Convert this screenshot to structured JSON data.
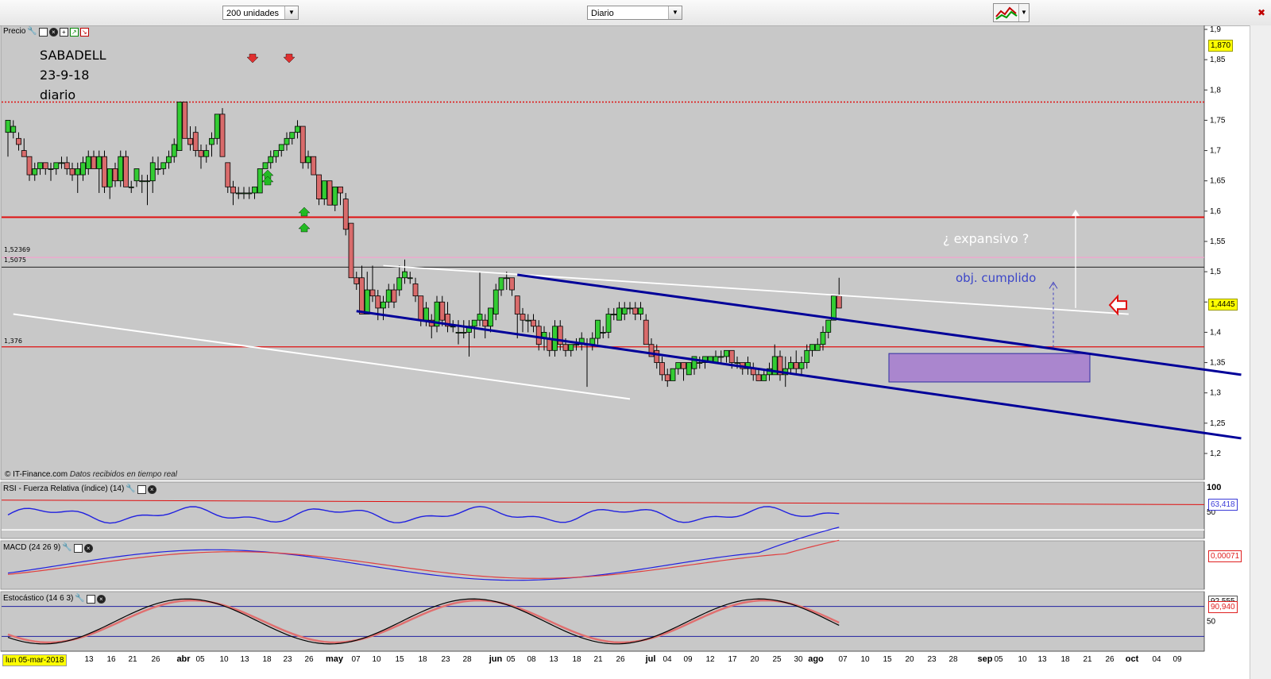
{
  "toolbar": {
    "units_select": "200 unidades",
    "period_select": "Diario",
    "chart_type_icon": "chart-type-icon",
    "close_icon": "close-icon"
  },
  "annotation": {
    "line1": "SABADELL",
    "line2": "23-9-18",
    "line3": "diario",
    "expansion": "¿ expansivo ?",
    "objective": "obj. cumplido"
  },
  "panels": {
    "price": "Precio",
    "rsi": "RSI - Fuerza Relativa (índice) (14)",
    "macd": "MACD (24 26 9)",
    "stoch": "Estocástico (14 6 3)"
  },
  "source_note": "© IT-Finance.com",
  "source_note_italic": "Datos recibidos en tiempo real",
  "current_date": "lun 05-mar-2018",
  "level_labels": {
    "top": "1,52369",
    "middle": "1,5075",
    "support": "1,376"
  },
  "price_tags": {
    "high": "1,870",
    "last": "1,4445",
    "rsi": "63,418",
    "macd": "0,00071",
    "stoch_a": "92,555",
    "stoch_b": "90,940"
  },
  "colors": {
    "background": "#c8c8c8",
    "bull": "#33cc33",
    "bear": "#d96b6b",
    "resistance": "#e01010",
    "channel": "#000099",
    "box": "#a070d0"
  },
  "chart_data": {
    "type": "candlestick",
    "title": "SABADELL",
    "ylim": [
      1.17,
      1.9
    ],
    "y_ticks": [
      "1,9",
      "1,85",
      "1,8",
      "1,75",
      "1,7",
      "1,65",
      "1,6",
      "1,55",
      "1,5",
      "1,45",
      "1,4",
      "1,35",
      "1,3",
      "1,25",
      "1,2"
    ],
    "x_ticks": [
      "13",
      "16",
      "21",
      "26",
      "abr",
      "05",
      "10",
      "13",
      "18",
      "23",
      "26",
      "may",
      "07",
      "10",
      "15",
      "18",
      "23",
      "28",
      "jun",
      "05",
      "08",
      "13",
      "18",
      "21",
      "26",
      "jul",
      "04",
      "09",
      "12",
      "17",
      "20",
      "25",
      "30",
      "ago",
      "07",
      "10",
      "15",
      "20",
      "23",
      "28",
      "sep",
      "05",
      "10",
      "13",
      "18",
      "21",
      "26",
      "oct",
      "04",
      "09"
    ],
    "horizontal_levels": [
      1.78,
      1.59,
      1.52369,
      1.5075,
      1.376
    ],
    "ohlc": [
      [
        1.73,
        1.75,
        1.69,
        1.75
      ],
      [
        1.73,
        1.75,
        1.72,
        1.74
      ],
      [
        1.72,
        1.73,
        1.7,
        1.71
      ],
      [
        1.7,
        1.72,
        1.69,
        1.69
      ],
      [
        1.69,
        1.69,
        1.65,
        1.66
      ],
      [
        1.66,
        1.68,
        1.65,
        1.67
      ],
      [
        1.67,
        1.68,
        1.66,
        1.68
      ],
      [
        1.68,
        1.68,
        1.66,
        1.67
      ],
      [
        1.67,
        1.68,
        1.65,
        1.67
      ],
      [
        1.67,
        1.68,
        1.66,
        1.68
      ],
      [
        1.68,
        1.69,
        1.67,
        1.68
      ],
      [
        1.68,
        1.69,
        1.66,
        1.67
      ],
      [
        1.67,
        1.68,
        1.65,
        1.66
      ],
      [
        1.66,
        1.68,
        1.63,
        1.67
      ],
      [
        1.66,
        1.69,
        1.65,
        1.68
      ],
      [
        1.67,
        1.7,
        1.66,
        1.69
      ],
      [
        1.69,
        1.7,
        1.67,
        1.67
      ],
      [
        1.67,
        1.7,
        1.63,
        1.69
      ],
      [
        1.69,
        1.7,
        1.63,
        1.64
      ],
      [
        1.64,
        1.67,
        1.62,
        1.67
      ],
      [
        1.67,
        1.68,
        1.64,
        1.65
      ],
      [
        1.65,
        1.7,
        1.64,
        1.69
      ],
      [
        1.69,
        1.7,
        1.64,
        1.64
      ],
      [
        1.64,
        1.65,
        1.63,
        1.64
      ],
      [
        1.65,
        1.67,
        1.64,
        1.67
      ],
      [
        1.65,
        1.66,
        1.63,
        1.65
      ],
      [
        1.65,
        1.66,
        1.61,
        1.65
      ],
      [
        1.65,
        1.69,
        1.63,
        1.68
      ],
      [
        1.67,
        1.69,
        1.66,
        1.67
      ],
      [
        1.67,
        1.68,
        1.66,
        1.68
      ],
      [
        1.68,
        1.7,
        1.67,
        1.69
      ],
      [
        1.69,
        1.72,
        1.68,
        1.71
      ],
      [
        1.7,
        1.78,
        1.7,
        1.78
      ],
      [
        1.78,
        1.78,
        1.72,
        1.72
      ],
      [
        1.72,
        1.74,
        1.7,
        1.71
      ],
      [
        1.73,
        1.74,
        1.69,
        1.7
      ],
      [
        1.7,
        1.71,
        1.67,
        1.69
      ],
      [
        1.69,
        1.71,
        1.68,
        1.7
      ],
      [
        1.71,
        1.73,
        1.69,
        1.72
      ],
      [
        1.72,
        1.76,
        1.71,
        1.76
      ],
      [
        1.76,
        1.77,
        1.69,
        1.69
      ],
      [
        1.68,
        1.68,
        1.63,
        1.64
      ],
      [
        1.64,
        1.65,
        1.61,
        1.63
      ],
      [
        1.63,
        1.64,
        1.62,
        1.63
      ],
      [
        1.63,
        1.64,
        1.62,
        1.63
      ],
      [
        1.63,
        1.64,
        1.62,
        1.63
      ],
      [
        1.63,
        1.64,
        1.62,
        1.64
      ],
      [
        1.63,
        1.67,
        1.63,
        1.67
      ],
      [
        1.67,
        1.68,
        1.67,
        1.68
      ],
      [
        1.68,
        1.7,
        1.67,
        1.69
      ],
      [
        1.69,
        1.7,
        1.68,
        1.7
      ],
      [
        1.7,
        1.71,
        1.69,
        1.71
      ],
      [
        1.71,
        1.73,
        1.7,
        1.72
      ],
      [
        1.72,
        1.73,
        1.71,
        1.73
      ],
      [
        1.73,
        1.75,
        1.72,
        1.74
      ],
      [
        1.74,
        1.74,
        1.67,
        1.68
      ],
      [
        1.68,
        1.7,
        1.67,
        1.69
      ],
      [
        1.69,
        1.69,
        1.66,
        1.66
      ],
      [
        1.66,
        1.66,
        1.61,
        1.62
      ],
      [
        1.62,
        1.65,
        1.61,
        1.65
      ],
      [
        1.65,
        1.65,
        1.61,
        1.61
      ],
      [
        1.61,
        1.64,
        1.6,
        1.64
      ],
      [
        1.64,
        1.64,
        1.61,
        1.63
      ],
      [
        1.62,
        1.63,
        1.56,
        1.57
      ],
      [
        1.58,
        1.58,
        1.49,
        1.49
      ],
      [
        1.49,
        1.5,
        1.47,
        1.48
      ],
      [
        1.49,
        1.51,
        1.43,
        1.43
      ],
      [
        1.43,
        1.5,
        1.43,
        1.47
      ],
      [
        1.47,
        1.51,
        1.45,
        1.46
      ],
      [
        1.46,
        1.47,
        1.42,
        1.44
      ],
      [
        1.44,
        1.46,
        1.42,
        1.45
      ],
      [
        1.45,
        1.48,
        1.44,
        1.47
      ],
      [
        1.47,
        1.48,
        1.44,
        1.45
      ],
      [
        1.47,
        1.51,
        1.46,
        1.49
      ],
      [
        1.49,
        1.52,
        1.48,
        1.5
      ],
      [
        1.49,
        1.5,
        1.48,
        1.49
      ],
      [
        1.48,
        1.49,
        1.45,
        1.46
      ],
      [
        1.46,
        1.46,
        1.41,
        1.42
      ],
      [
        1.42,
        1.45,
        1.41,
        1.44
      ],
      [
        1.42,
        1.43,
        1.39,
        1.41
      ],
      [
        1.41,
        1.46,
        1.4,
        1.45
      ],
      [
        1.45,
        1.46,
        1.41,
        1.42
      ],
      [
        1.43,
        1.45,
        1.4,
        1.41
      ],
      [
        1.41,
        1.42,
        1.4,
        1.41
      ],
      [
        1.4,
        1.42,
        1.38,
        1.4
      ],
      [
        1.4,
        1.42,
        1.39,
        1.4
      ],
      [
        1.4,
        1.42,
        1.36,
        1.41
      ],
      [
        1.41,
        1.42,
        1.39,
        1.42
      ],
      [
        1.42,
        1.5,
        1.41,
        1.43
      ],
      [
        1.42,
        1.43,
        1.39,
        1.41
      ],
      [
        1.41,
        1.44,
        1.4,
        1.44
      ],
      [
        1.43,
        1.48,
        1.42,
        1.47
      ],
      [
        1.47,
        1.49,
        1.46,
        1.49
      ],
      [
        1.49,
        1.5,
        1.47,
        1.49
      ],
      [
        1.49,
        1.49,
        1.46,
        1.47
      ],
      [
        1.46,
        1.46,
        1.39,
        1.43
      ],
      [
        1.43,
        1.44,
        1.4,
        1.42
      ],
      [
        1.42,
        1.43,
        1.4,
        1.42
      ],
      [
        1.42,
        1.43,
        1.4,
        1.41
      ],
      [
        1.41,
        1.42,
        1.37,
        1.38
      ],
      [
        1.39,
        1.41,
        1.37,
        1.4
      ],
      [
        1.39,
        1.4,
        1.36,
        1.37
      ],
      [
        1.37,
        1.42,
        1.36,
        1.41
      ],
      [
        1.41,
        1.42,
        1.37,
        1.38
      ],
      [
        1.38,
        1.39,
        1.36,
        1.37
      ],
      [
        1.37,
        1.38,
        1.36,
        1.38
      ],
      [
        1.38,
        1.39,
        1.37,
        1.38
      ],
      [
        1.38,
        1.4,
        1.37,
        1.39
      ],
      [
        1.38,
        1.39,
        1.31,
        1.38
      ],
      [
        1.38,
        1.4,
        1.37,
        1.39
      ],
      [
        1.39,
        1.42,
        1.38,
        1.42
      ],
      [
        1.4,
        1.41,
        1.39,
        1.4
      ],
      [
        1.4,
        1.44,
        1.39,
        1.43
      ],
      [
        1.43,
        1.44,
        1.42,
        1.43
      ],
      [
        1.42,
        1.45,
        1.42,
        1.44
      ],
      [
        1.43,
        1.45,
        1.42,
        1.44
      ],
      [
        1.44,
        1.45,
        1.43,
        1.44
      ],
      [
        1.44,
        1.45,
        1.42,
        1.43
      ],
      [
        1.43,
        1.45,
        1.42,
        1.44
      ],
      [
        1.42,
        1.43,
        1.38,
        1.38
      ],
      [
        1.38,
        1.39,
        1.36,
        1.36
      ],
      [
        1.37,
        1.38,
        1.34,
        1.35
      ],
      [
        1.35,
        1.36,
        1.32,
        1.33
      ],
      [
        1.33,
        1.34,
        1.31,
        1.32
      ],
      [
        1.32,
        1.34,
        1.32,
        1.34
      ],
      [
        1.34,
        1.35,
        1.33,
        1.35
      ],
      [
        1.35,
        1.35,
        1.32,
        1.34
      ],
      [
        1.33,
        1.35,
        1.33,
        1.35
      ],
      [
        1.34,
        1.36,
        1.33,
        1.36
      ],
      [
        1.35,
        1.36,
        1.34,
        1.35
      ],
      [
        1.35,
        1.36,
        1.34,
        1.36
      ],
      [
        1.35,
        1.36,
        1.35,
        1.36
      ],
      [
        1.35,
        1.37,
        1.35,
        1.36
      ],
      [
        1.36,
        1.37,
        1.35,
        1.36
      ],
      [
        1.36,
        1.37,
        1.35,
        1.37
      ],
      [
        1.37,
        1.37,
        1.34,
        1.35
      ],
      [
        1.35,
        1.36,
        1.34,
        1.35
      ],
      [
        1.35,
        1.35,
        1.33,
        1.34
      ],
      [
        1.34,
        1.36,
        1.33,
        1.35
      ],
      [
        1.34,
        1.35,
        1.32,
        1.33
      ],
      [
        1.33,
        1.34,
        1.32,
        1.32
      ],
      [
        1.32,
        1.34,
        1.32,
        1.33
      ],
      [
        1.33,
        1.35,
        1.32,
        1.34
      ],
      [
        1.33,
        1.38,
        1.33,
        1.36
      ],
      [
        1.36,
        1.37,
        1.32,
        1.33
      ],
      [
        1.33,
        1.36,
        1.31,
        1.34
      ],
      [
        1.34,
        1.36,
        1.33,
        1.35
      ],
      [
        1.35,
        1.37,
        1.33,
        1.34
      ],
      [
        1.34,
        1.36,
        1.33,
        1.35
      ],
      [
        1.35,
        1.38,
        1.34,
        1.37
      ],
      [
        1.37,
        1.38,
        1.36,
        1.38
      ],
      [
        1.37,
        1.39,
        1.37,
        1.38
      ],
      [
        1.38,
        1.41,
        1.37,
        1.4
      ],
      [
        1.4,
        1.42,
        1.39,
        1.42
      ],
      [
        1.42,
        1.46,
        1.42,
        1.46
      ],
      [
        1.46,
        1.49,
        1.44,
        1.44
      ]
    ],
    "trend_lines": [
      {
        "name": "directriz bajista",
        "points": [
          [
            1,
            1.43
          ],
          [
            116,
            1.29
          ]
        ]
      },
      {
        "name": "directriz superior",
        "points": [
          [
            70,
            1.51
          ],
          [
            209,
            1.43
          ]
        ]
      },
      {
        "name": "canal superior",
        "points": [
          [
            95,
            1.495
          ],
          [
            230,
            1.33
          ]
        ]
      },
      {
        "name": "canal inferior",
        "points": [
          [
            65,
            1.435
          ],
          [
            230,
            1.225
          ]
        ]
      }
    ],
    "rsi": {
      "ylim": [
        0,
        100
      ],
      "levels": [
        70,
        30
      ],
      "last": 63.418
    },
    "macd": {
      "last": 0.00071
    },
    "stochastic": {
      "ylim": [
        0,
        100
      ],
      "levels": [
        80,
        20
      ],
      "last_k": 92.555,
      "last_d": 90.94
    }
  }
}
